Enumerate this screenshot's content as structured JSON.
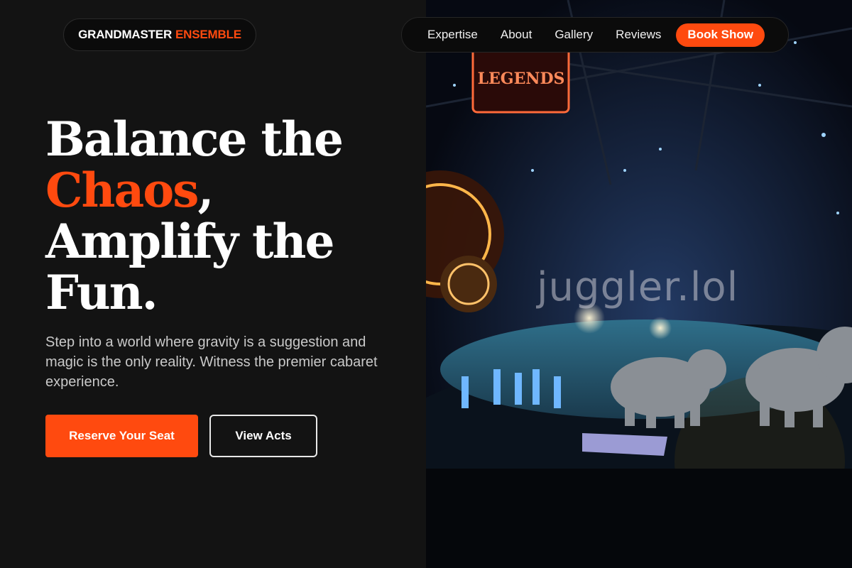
{
  "logo": {
    "part1": "GRANDMASTER",
    "part2": "ENSEMBLE"
  },
  "nav": {
    "links": [
      "Expertise",
      "About",
      "Gallery",
      "Reviews"
    ],
    "cta": "Book Show"
  },
  "hero": {
    "line1": "Balance the",
    "highlight": "Chaos",
    "comma": ",",
    "line3": "Amplify the",
    "line4": "Fun.",
    "lead": "Step into a world where gravity is a suggestion and magic is the only reality. Witness the premier cabaret experience.",
    "primary_button": "Reserve Your Seat",
    "secondary_button": "View Acts"
  },
  "image": {
    "sign_text": "LEGENDS",
    "watermark": "juggler.lol"
  },
  "colors": {
    "accent": "#ff4a0f",
    "background": "#131313"
  }
}
